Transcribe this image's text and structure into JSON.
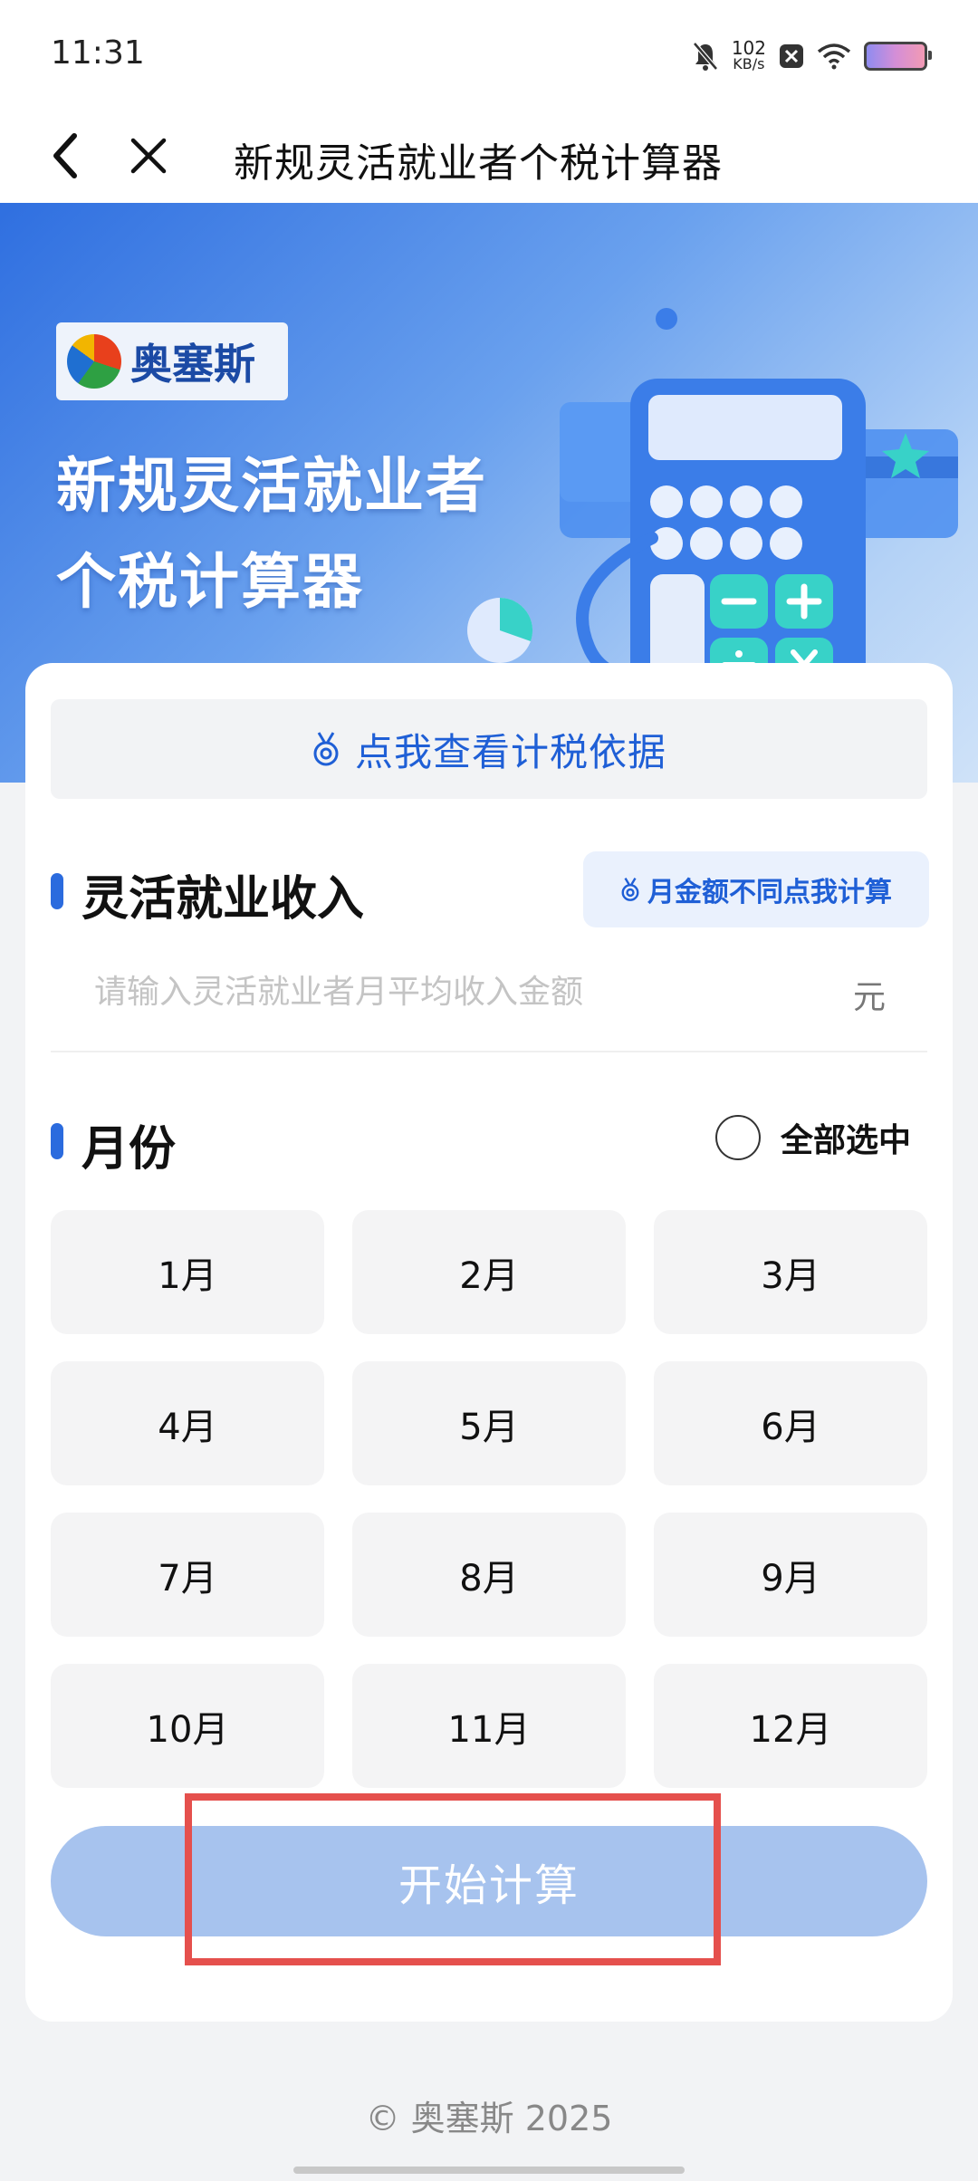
{
  "status": {
    "time": "11:31",
    "net_speed_value": "102",
    "net_speed_unit": "KB/s"
  },
  "nav": {
    "title": "新规灵活就业者个税计算器"
  },
  "banner": {
    "brand": "奥塞斯",
    "title_line1": "新规灵活就业者",
    "title_line2": "个税计算器"
  },
  "basis": {
    "label": "点我查看计税依据"
  },
  "income": {
    "section_title": "灵活就业收入",
    "monthly_button": "月金额不同点我计算",
    "placeholder": "请输入灵活就业者月平均收入金额",
    "value": "",
    "unit": "元"
  },
  "months": {
    "section_title": "月份",
    "select_all_label": "全部选中",
    "items": [
      "1月",
      "2月",
      "3月",
      "4月",
      "5月",
      "6月",
      "7月",
      "8月",
      "9月",
      "10月",
      "11月",
      "12月"
    ]
  },
  "action": {
    "calculate_label": "开始计算"
  },
  "footer": {
    "copyright": "© 奥塞斯 2025"
  },
  "colors": {
    "accent": "#2b6bde",
    "button_disabled": "#a7c3ee",
    "highlight": "#e5504d"
  }
}
